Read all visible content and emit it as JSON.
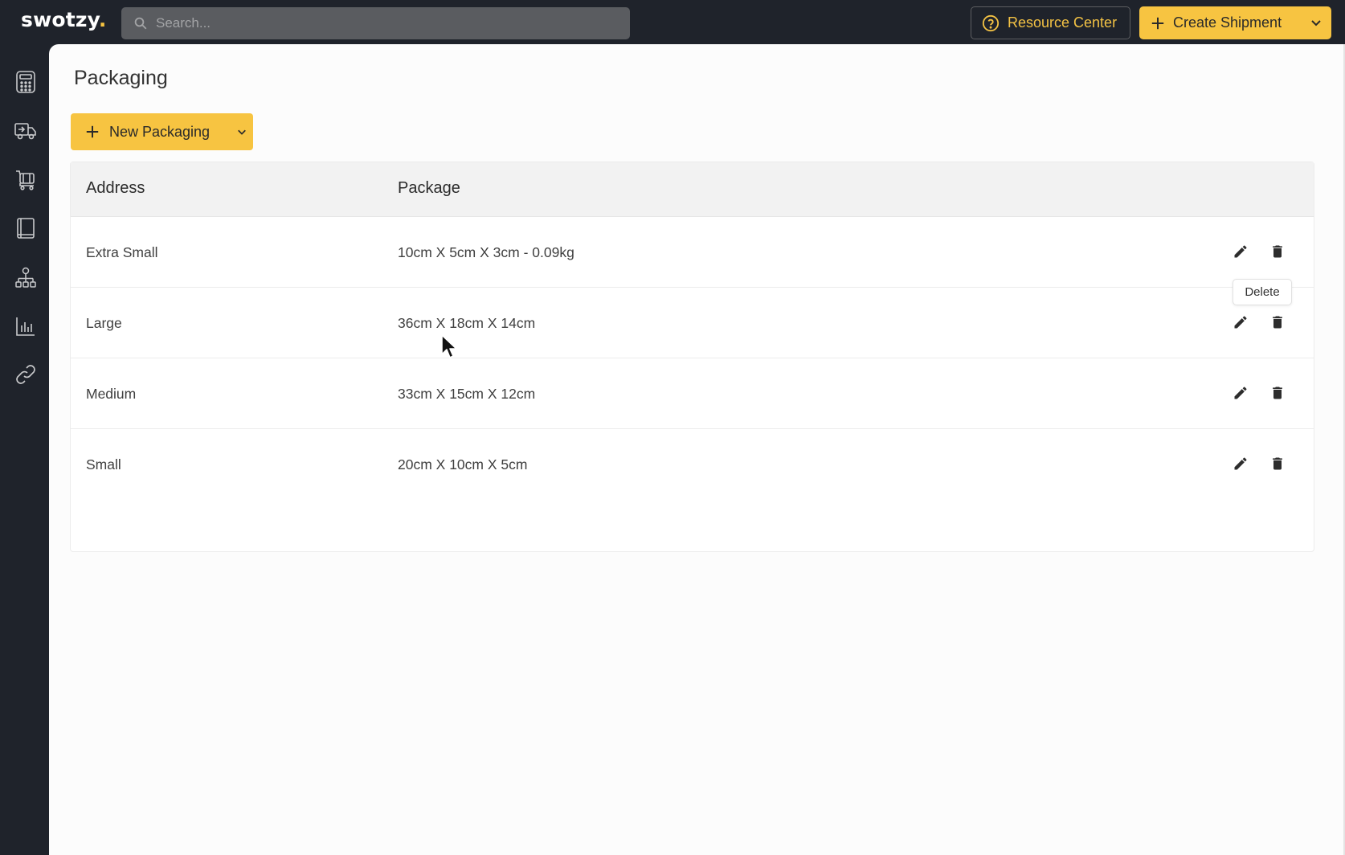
{
  "app": {
    "logo_text": "swotzy",
    "logo_dot": ".",
    "accent_color": "#f7c441",
    "nav_bg_color": "#1f232b"
  },
  "header": {
    "search": {
      "placeholder": "Search...",
      "value": ""
    },
    "resource_center_label": "Resource Center",
    "create_shipment_label": "Create Shipment"
  },
  "sidebar": {
    "items": [
      {
        "icon": "calculator-icon"
      },
      {
        "icon": "truck-icon"
      },
      {
        "icon": "cart-icon"
      },
      {
        "icon": "book-icon"
      },
      {
        "icon": "hierarchy-icon"
      },
      {
        "icon": "bar-chart-icon"
      },
      {
        "icon": "link-icon"
      }
    ]
  },
  "page": {
    "title": "Packaging",
    "new_button_label": "New Packaging"
  },
  "table": {
    "columns": [
      "Address",
      "Package"
    ],
    "rows": [
      {
        "address": "Extra Small",
        "package": "10cm X 5cm X 3cm - 0.09kg"
      },
      {
        "address": "Large",
        "package": "36cm X 18cm X 14cm"
      },
      {
        "address": "Medium",
        "package": "33cm X 15cm X 12cm"
      },
      {
        "address": "Small",
        "package": "20cm X 10cm X 5cm"
      }
    ]
  },
  "tooltip": {
    "text": "Delete"
  }
}
